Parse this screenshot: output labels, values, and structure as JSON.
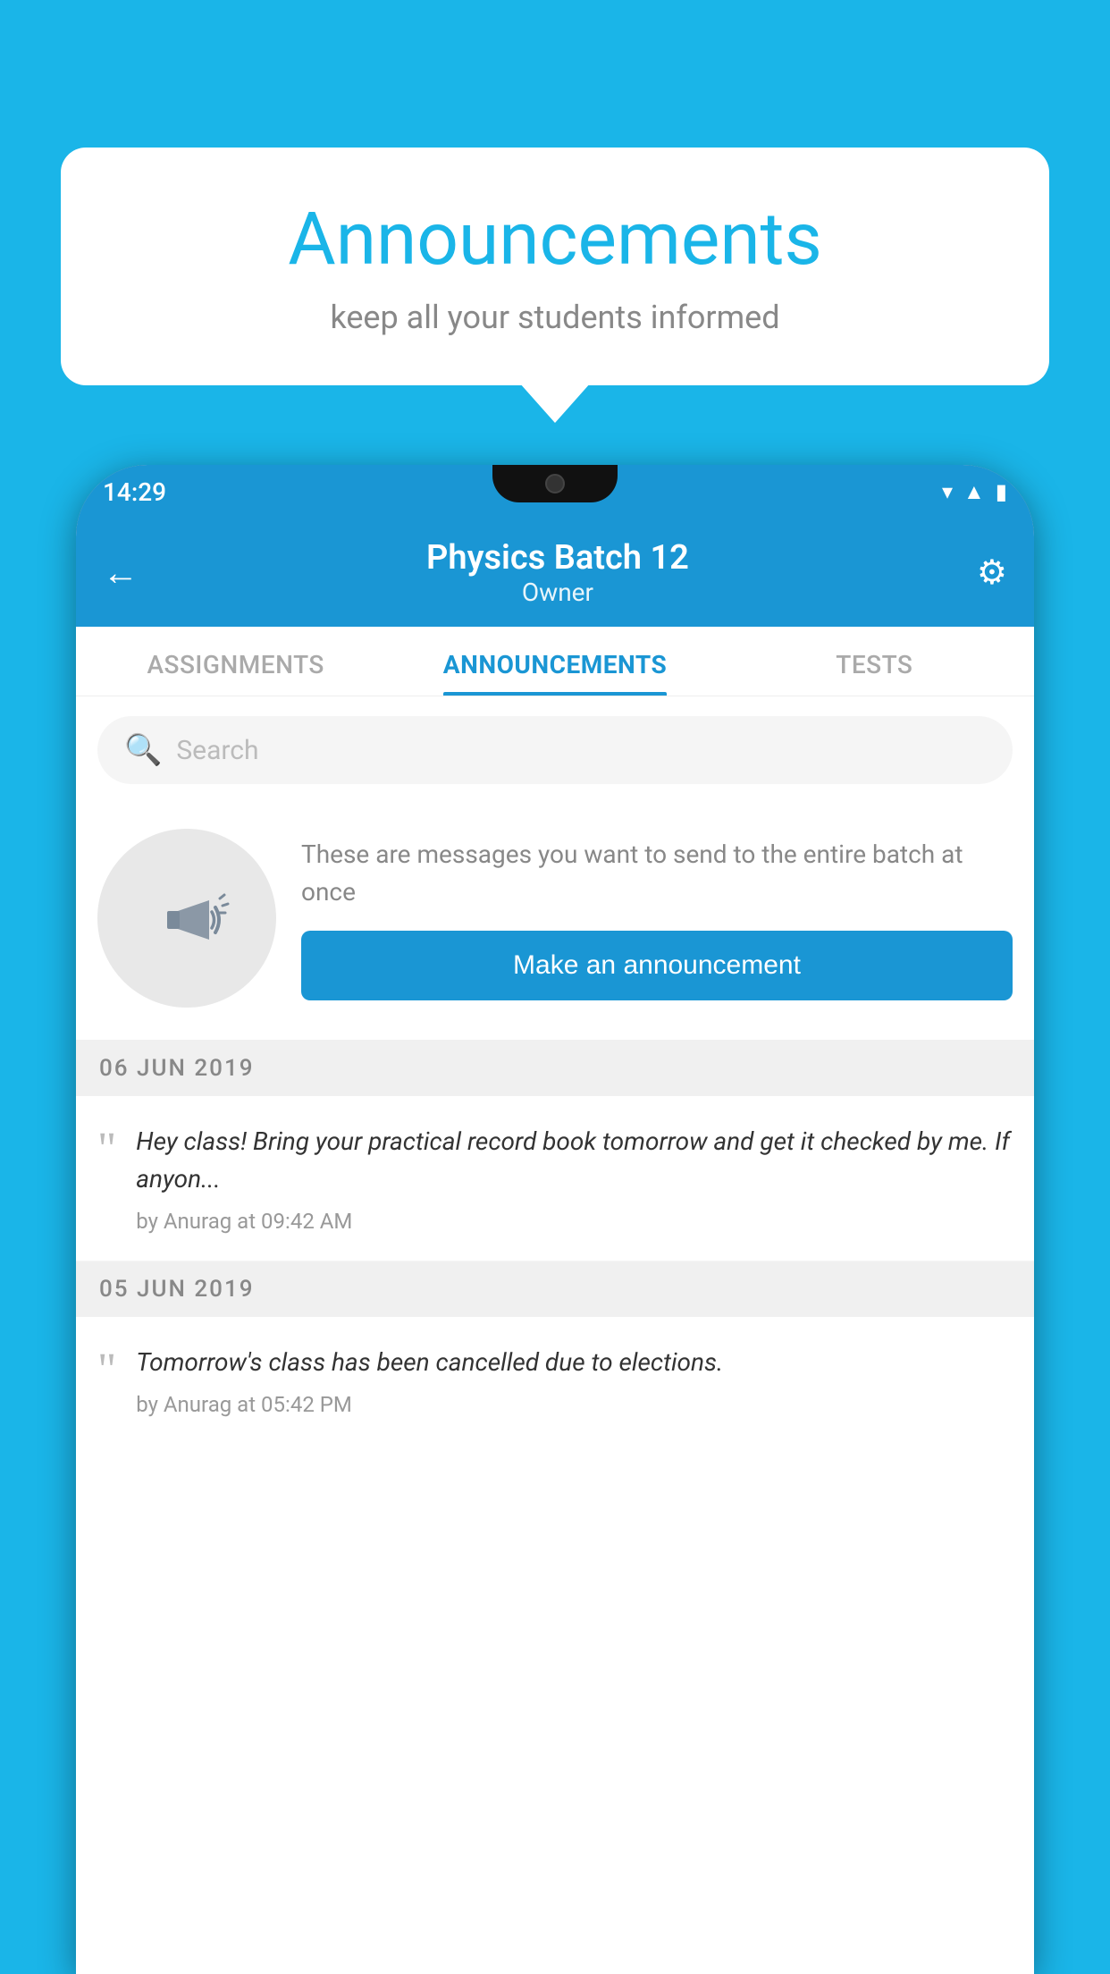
{
  "background_color": "#1ab5e8",
  "speech_bubble": {
    "title": "Announcements",
    "subtitle": "keep all your students informed"
  },
  "phone": {
    "status_bar": {
      "time": "14:29",
      "icons": [
        "wifi",
        "signal",
        "battery"
      ]
    },
    "header": {
      "title": "Physics Batch 12",
      "subtitle": "Owner"
    },
    "tabs": [
      {
        "label": "ASSIGNMENTS",
        "active": false
      },
      {
        "label": "ANNOUNCEMENTS",
        "active": true
      },
      {
        "label": "TESTS",
        "active": false
      },
      {
        "label": "...",
        "active": false
      }
    ],
    "search": {
      "placeholder": "Search"
    },
    "promo": {
      "description": "These are messages you want to send to the entire batch at once",
      "button_label": "Make an announcement"
    },
    "announcements": [
      {
        "date": "06  JUN  2019",
        "message": "Hey class! Bring your practical record book tomorrow and get it checked by me. If anyon...",
        "author": "by Anurag at 09:42 AM"
      },
      {
        "date": "05  JUN  2019",
        "message": "Tomorrow's class has been cancelled due to elections.",
        "author": "by Anurag at 05:42 PM"
      }
    ]
  }
}
